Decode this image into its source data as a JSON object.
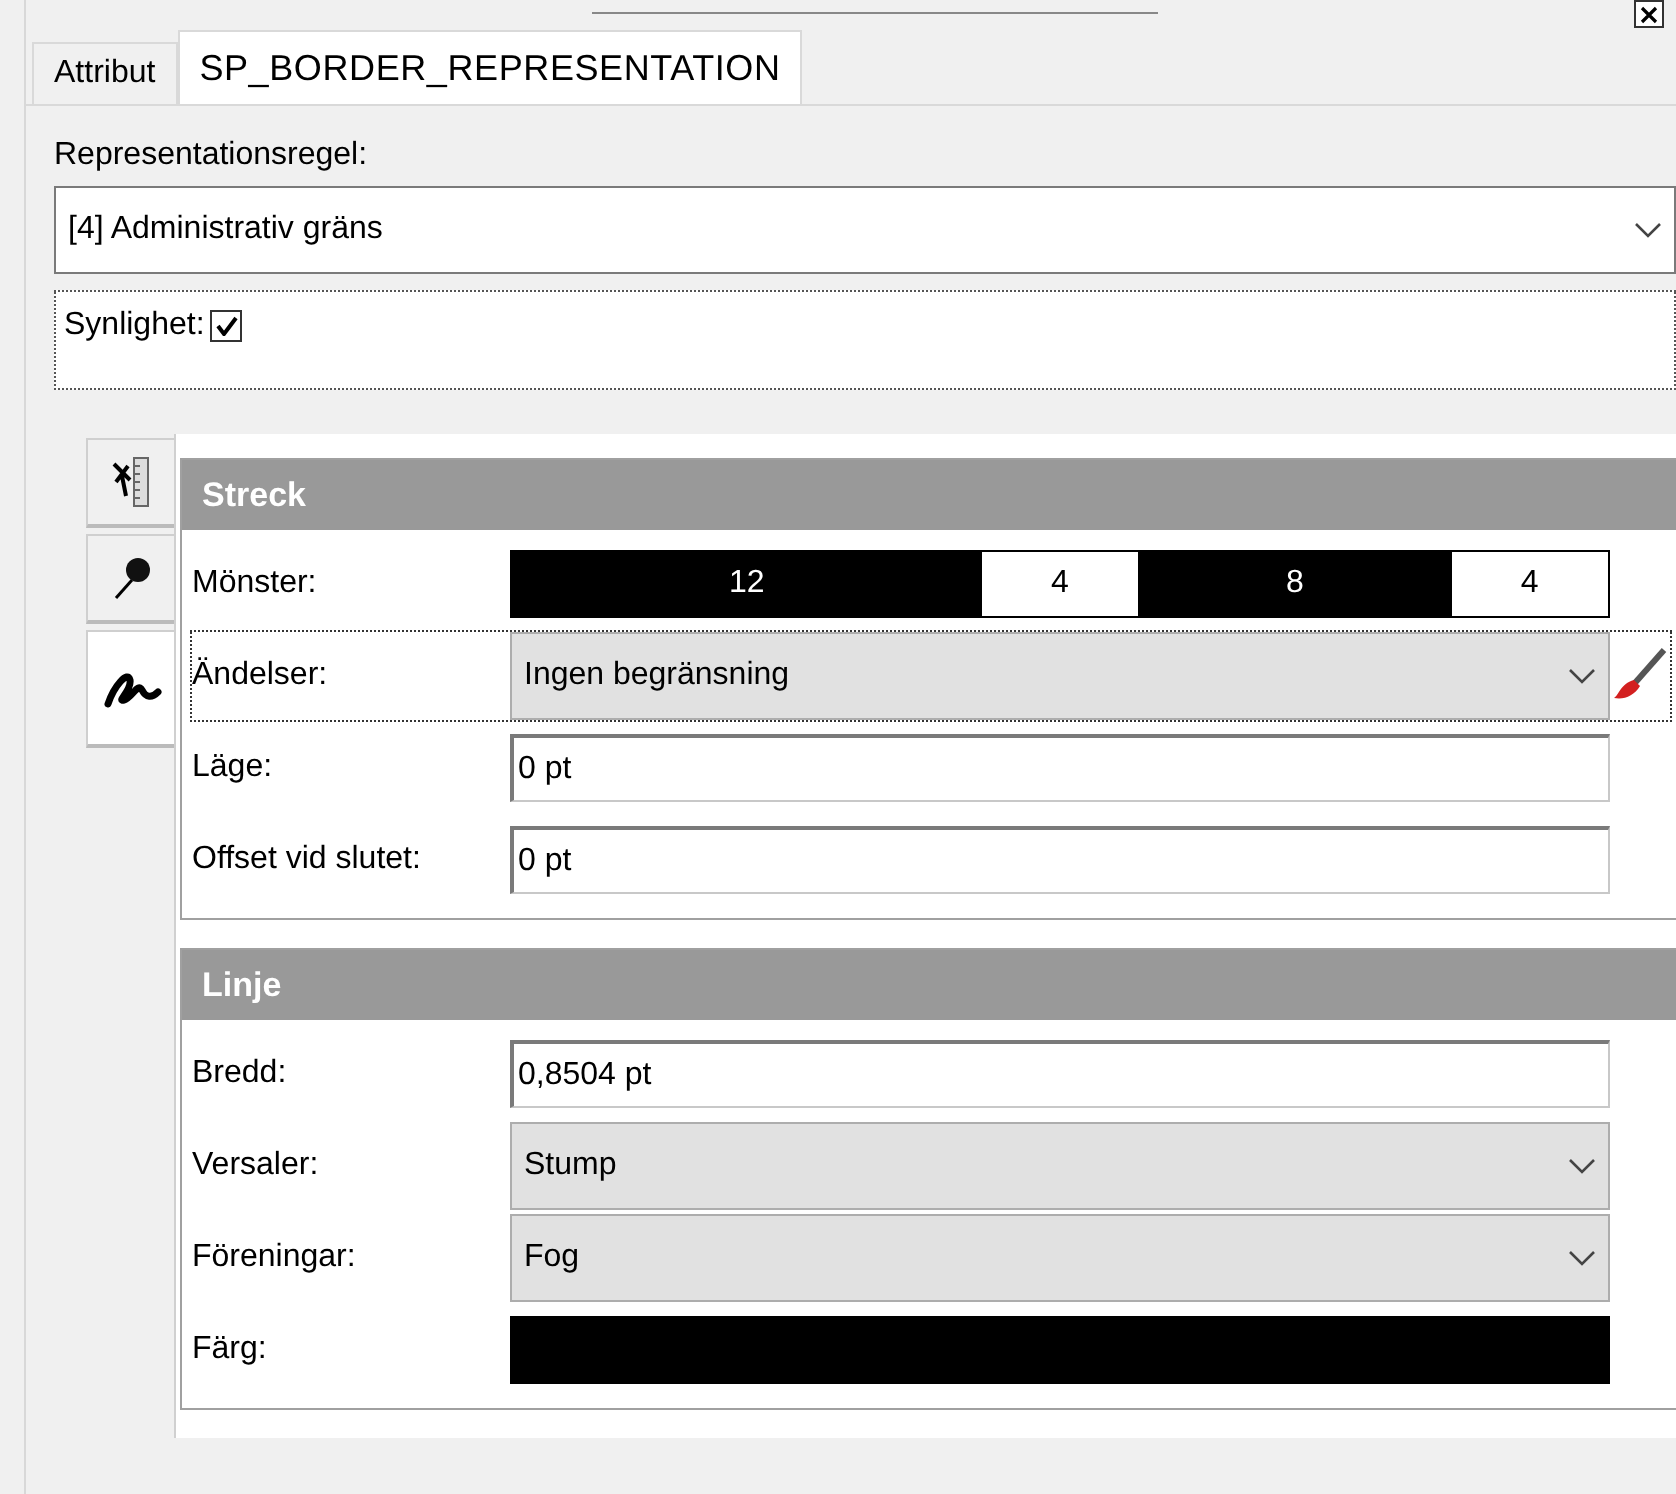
{
  "tabs": [
    {
      "label": "Attribut",
      "selected": false
    },
    {
      "label": "SP_BORDER_REPRESENTATION",
      "selected": true
    }
  ],
  "rule": {
    "label": "Representationsregel:",
    "value": "[4] Administrativ gräns"
  },
  "visibility": {
    "label": "Synlighet:",
    "checked": true
  },
  "side_tabs": [
    {
      "kind": "ruler",
      "selected": false
    },
    {
      "kind": "pin",
      "selected": false
    },
    {
      "kind": "squiggle",
      "selected": true
    }
  ],
  "sections": [
    {
      "title": "Streck",
      "rows": [
        {
          "kind": "pattern",
          "label": "Mönster:",
          "segments": [
            {
              "kind": "dash",
              "text": "12"
            },
            {
              "kind": "gap",
              "text": "4"
            },
            {
              "kind": "dash",
              "text": "8"
            },
            {
              "kind": "gap",
              "text": "4"
            }
          ]
        },
        {
          "kind": "dropdown",
          "label": "Ändelser:",
          "value": "Ingen begränsning",
          "focused": true,
          "brush": true
        },
        {
          "kind": "input",
          "label": "Läge:",
          "value": "0 pt"
        },
        {
          "kind": "input",
          "label": "Offset vid slutet:",
          "value": "0 pt"
        }
      ]
    },
    {
      "title": "Linje",
      "rows": [
        {
          "kind": "input",
          "label": "Bredd:",
          "value": "0,8504 pt"
        },
        {
          "kind": "dropdown",
          "label": "Versaler:",
          "value": "Stump",
          "focused": false,
          "brush": false
        },
        {
          "kind": "dropdown",
          "label": "Föreningar:",
          "value": "Fog",
          "focused": false,
          "brush": false
        },
        {
          "kind": "color",
          "label": "Färg:",
          "color": "#000000"
        }
      ]
    }
  ]
}
